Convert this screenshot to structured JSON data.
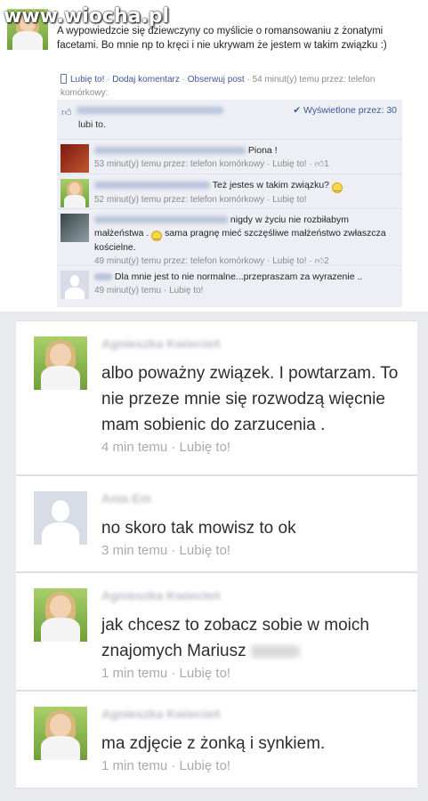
{
  "watermark": "www.wiocha.pl",
  "post": {
    "text": "A wypowiedzcie się dziewczyny co myślicie o romansowaniu z żonatymi facetami. Bo mnie np to kręci i nie ukrywam że jestem w takim związku :)",
    "like_link": "Lubię to!",
    "comment_link": "Dodaj komentarz",
    "follow_link": "Obserwuj post",
    "sep": " · ",
    "meta": "54 minut(y) temu przez: telefon komórkowy:"
  },
  "likes": {
    "suffix": "lubi to.",
    "seen": "✔ Wyświetlone przez: 30"
  },
  "comments": [
    {
      "text": "Piona !",
      "meta": "53 minut(y) temu przez: telefon komórkowy ·",
      "like": "Lubię to!",
      "count": "1"
    },
    {
      "text": "Też jestes w takim związku?",
      "meta": "52 minut(y) temu przez: telefon komórkowy ·",
      "like": "Lubię to!"
    },
    {
      "text": "nigdy w życiu nie rozbiłabym małżeństwa .",
      "text2": "sama pragnę mieć szczęśliwe małżeństwo zwłaszcza kościelne.",
      "meta": "49 minut(y) temu przez: telefon komórkowy ·",
      "like": "Lubię to!",
      "count": "2"
    },
    {
      "name": "Ania Em",
      "text": "Dla mnie jest to nie normalne...przepraszam za wyrazenie ..",
      "meta": "49 minut(y) temu ·",
      "like": "Lubię to!"
    }
  ],
  "mobile": [
    {
      "name": "Agnieszka Kwiecień",
      "text": "albo poważny związek. I powtarzam. To nie przeze mnie się rozwodzą więcnie mam sobienic do zarzucenia .",
      "time": "4 min temu",
      "like": "Lubię to!"
    },
    {
      "name": "Ania Em",
      "text": "no skoro tak mowisz to ok",
      "time": "3 min temu",
      "like": "Lubię to!"
    },
    {
      "name": "Agnieszka Kwiecień",
      "text": "jak chcesz to zobacz sobie w moich znajomych Mariusz",
      "time": "1 min temu",
      "like": "Lubię to!"
    },
    {
      "name": "Agnieszka Kwiecień",
      "text": "ma zdjęcie z żonką i synkiem.",
      "time": "1 min temu",
      "like": "Lubię to!"
    }
  ],
  "icons": {
    "thumb": "thumbs-up-icon",
    "phone": "mobile-phone-icon",
    "check": "check-icon",
    "smile": "smiley-icon",
    "avatar": "profile-photo"
  }
}
